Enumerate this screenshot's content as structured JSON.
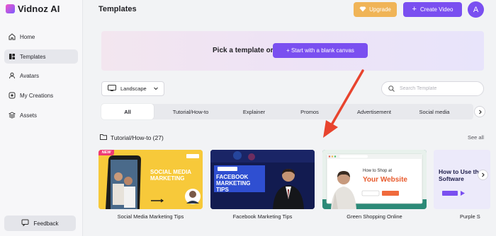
{
  "app": {
    "name": "Vidnoz AI"
  },
  "sidebar": {
    "items": [
      {
        "label": "Home",
        "icon": "home-icon"
      },
      {
        "label": "Templates",
        "icon": "templates-icon",
        "active": true
      },
      {
        "label": "Avatars",
        "icon": "avatar-icon"
      },
      {
        "label": "My Creations",
        "icon": "creations-icon"
      },
      {
        "label": "Assets",
        "icon": "assets-icon"
      }
    ],
    "feedback_label": "Feedback"
  },
  "header": {
    "title": "Templates",
    "upgrade_label": "Upgrade",
    "create_label": "Create Video",
    "avatar_initial": "A"
  },
  "banner": {
    "text": "Pick a template or",
    "button_label": "+ Start with a blank canvas"
  },
  "filters": {
    "orientation": "Landscape",
    "search_placeholder": "Search Template"
  },
  "tabs": [
    "All",
    "Tutorial/How-to",
    "Explainer",
    "Promos",
    "Advertisement",
    "Social media"
  ],
  "active_tab": "All",
  "section": {
    "title": "Tutorial/How-to (27)",
    "see_all": "See all"
  },
  "cards": [
    {
      "label": "Social Media Marketing Tips",
      "badge": "NEW",
      "thumb_text": "SOCIAL MEDIA MARKETING"
    },
    {
      "label": "Facebook Marketing Tips",
      "thumb_text": "FACEBOOK MARKETING TIPS"
    },
    {
      "label": "Green Shopping Online",
      "thumb_small": "How to Shop at",
      "thumb_text": "Your Website"
    },
    {
      "label": "Purple S",
      "thumb_text": "How to Use the Software"
    }
  ],
  "colors": {
    "accent": "#7a4ff0",
    "upgrade": "#f0b457",
    "arrow": "#e8442e"
  }
}
